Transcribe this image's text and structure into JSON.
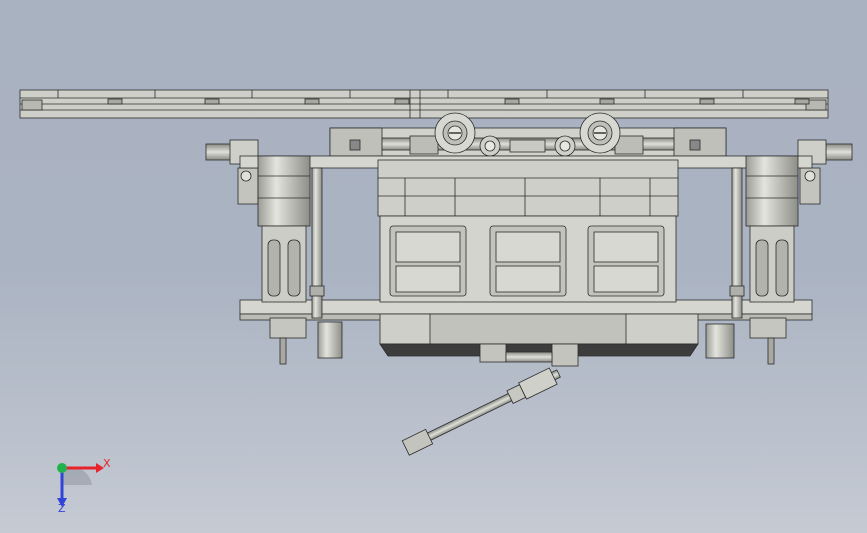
{
  "scene": {
    "background_top": "#a9b2c1",
    "background_bottom": "#c5cad3",
    "part_fill": "#c8c8c2",
    "part_fill_light": "#dcdcd6",
    "part_fill_dark": "#a9a9a3",
    "edge_color": "#2b2b2b",
    "shadow_fill": "#3d3d3d"
  },
  "triad": {
    "x_axis_label": "X",
    "z_axis_label": "Z",
    "x_color": "#e8232a",
    "y_color": "#22b24c",
    "z_color": "#3045d8"
  }
}
